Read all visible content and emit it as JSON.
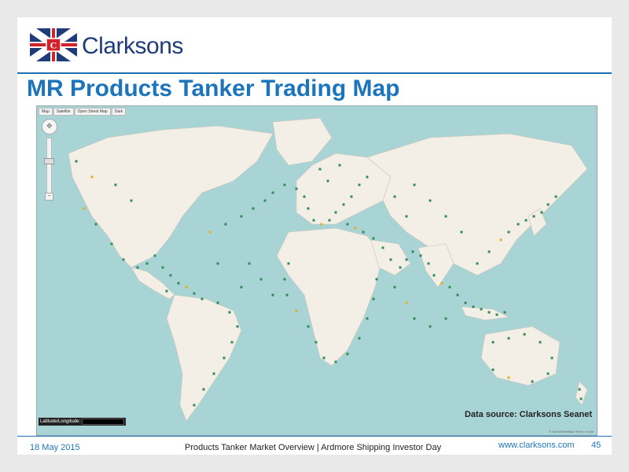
{
  "brand": {
    "name": "Clarksons",
    "badge_letter": "C",
    "colors": {
      "navy": "#1f3b78",
      "accent": "#1c75bc",
      "red": "#d2232a"
    }
  },
  "slide": {
    "title": "MR Products Tanker Trading Map"
  },
  "map": {
    "tabs": [
      "Map",
      "Satellite",
      "Open Street Map",
      "Dark"
    ],
    "latlon_label": "Latitude/Longitude:",
    "data_source": "Data source: Clarksons Seanet",
    "attribution": "© OpenStreetMap  Terms of Use",
    "colors": {
      "ocean": "#a9d4d5",
      "land": "#f3efe6",
      "vessel": "#2e8b57",
      "vessel_alt": "#e0b020"
    }
  },
  "footer": {
    "date": "18 May 2015",
    "center": "Products Tanker Market Overview | Ardmore Shipping Investor Day",
    "url": "www.clarksons.com",
    "page": "45"
  }
}
